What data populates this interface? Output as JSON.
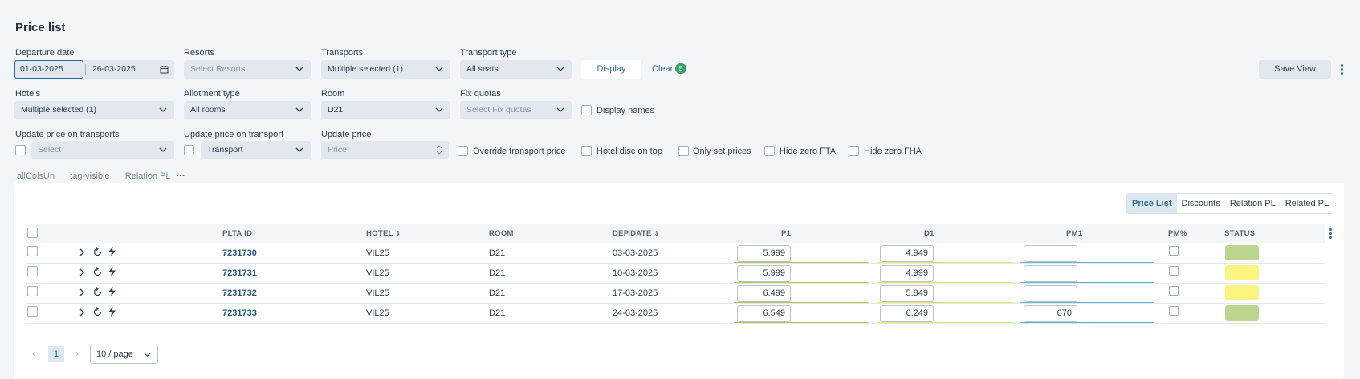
{
  "page_title": "Price list",
  "filters": {
    "departure_date_label": "Departure date",
    "date_from": "01-03-2025",
    "date_to": "26-03-2025",
    "resorts_label": "Resorts",
    "resorts_placeholder": "Select Resorts",
    "transports_label": "Transports",
    "transports_value": "Multiple selected (1)",
    "transport_type_label": "Transport type",
    "transport_type_value": "All seats",
    "display_label": "Display",
    "clear_label": "Clear",
    "clear_count": "5",
    "save_view_label": "Save View",
    "hotels_label": "Hotels",
    "hotels_value": "Multiple selected (1)",
    "allotment_label": "Allotment type",
    "allotment_value": "All rooms",
    "room_label": "Room",
    "room_value": "D21",
    "fix_quotas_label": "Fix quotas",
    "fix_quotas_placeholder": "Select Fix quotas",
    "display_names_label": "Display names",
    "upd_transports_label": "Update price on transports",
    "upd_transports_placeholder": "Select",
    "upd_transport_label": "Update price on transport",
    "upd_transport_value": "Transport",
    "update_price_label": "Update price",
    "update_price_placeholder": "Price",
    "override_label": "Override transport price",
    "hotel_disc_label": "Hotel disc on top",
    "only_set_label": "Only set prices",
    "hide_fta_label": "Hide zero FTA",
    "hide_fha_label": "Hide zero FHA"
  },
  "tags": [
    "allColsUn",
    "tag-visible",
    "Relation PL"
  ],
  "tabs": [
    "Price List",
    "Discounts",
    "Relation PL",
    "Related PL"
  ],
  "table": {
    "headers": {
      "plta_id": "PLTA ID",
      "hotel": "HOTEL",
      "room": "ROOM",
      "dep_date": "DEP.DATE",
      "p1": "P1",
      "d1": "D1",
      "pm1": "PM1",
      "pm_pct": "PM%",
      "status": "STATUS"
    },
    "rows": [
      {
        "id": "7231730",
        "hotel": "VIL25",
        "room": "D21",
        "dep_date": "03-03-2025",
        "p1": "5.999",
        "d1": "4.949",
        "pm1": "",
        "status_color": "#bcd68f"
      },
      {
        "id": "7231731",
        "hotel": "VIL25",
        "room": "D21",
        "dep_date": "10-03-2025",
        "p1": "5.999",
        "d1": "4.999",
        "pm1": "",
        "status_color": "#fbf47e"
      },
      {
        "id": "7231732",
        "hotel": "VIL25",
        "room": "D21",
        "dep_date": "17-03-2025",
        "p1": "6.499",
        "d1": "5.849",
        "pm1": "",
        "status_color": "#fbf47e"
      },
      {
        "id": "7231733",
        "hotel": "VIL25",
        "room": "D21",
        "dep_date": "24-03-2025",
        "p1": "6.549",
        "d1": "6.249",
        "pm1": "670",
        "status_color": "#bcd68f"
      }
    ]
  },
  "pagination": {
    "current_page": "1",
    "page_size": "10 / page"
  },
  "colors": {
    "accent": "#2b6d8f",
    "p1_underline": "#b7c94a",
    "d1_underline": "#f0e65a",
    "pm1_underline": "#5fb7c9"
  }
}
